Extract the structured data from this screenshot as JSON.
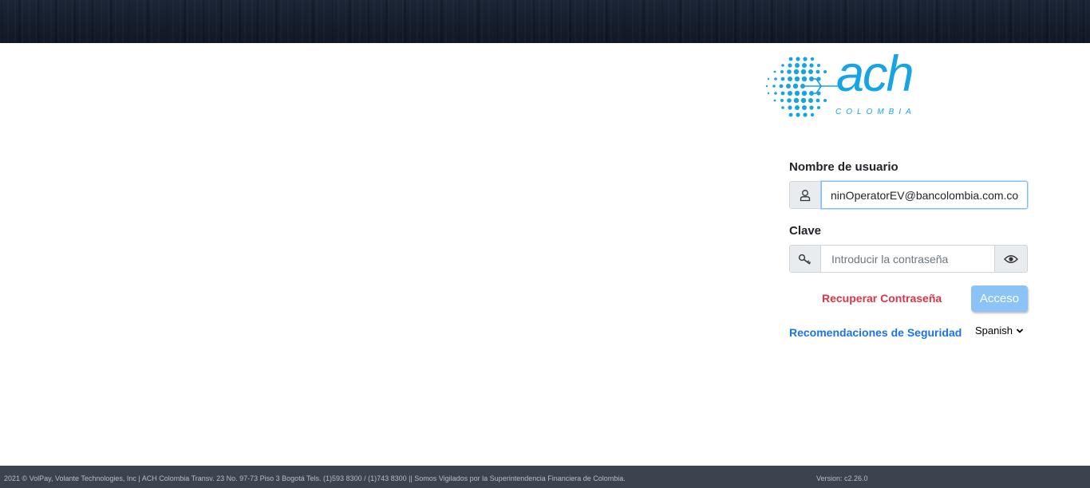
{
  "header": {
    "banner": ""
  },
  "logo": {
    "word": "ach",
    "subtitle": "COLOMBIA",
    "brand_color": "#16a4e3"
  },
  "login_form": {
    "username_label": "Nombre de usuario",
    "username_value": "ninOperatorEV@bancolombia.com.co",
    "username_icon": "user-icon",
    "password_label": "Clave",
    "password_placeholder": "Introducir la contraseña",
    "password_icon": "key-icon",
    "show_password_icon": "eye-icon",
    "recover_link": "Recuperar Contraseña",
    "submit_label": "Acceso",
    "security_link": "Recomendaciones de Seguridad",
    "language": {
      "selected": "Spanish",
      "icon": "chevron-down-icon"
    }
  },
  "colors": {
    "link_red": "#dc3545",
    "link_blue": "#1a73e8",
    "button": "#8cc3f6",
    "footer_bg": "#3a434e"
  },
  "footer": {
    "text": "2021 © VolPay, Volante Technologies, Inc | ACH Colombia Transv. 23 No. 97-73 Piso 3 Bogotá Tels. (1)593 8300 / (1)743 8300 || Somos Vigilados por la Superintendencia Financiera de Colombia.",
    "version": "Version: c2.26.0"
  }
}
